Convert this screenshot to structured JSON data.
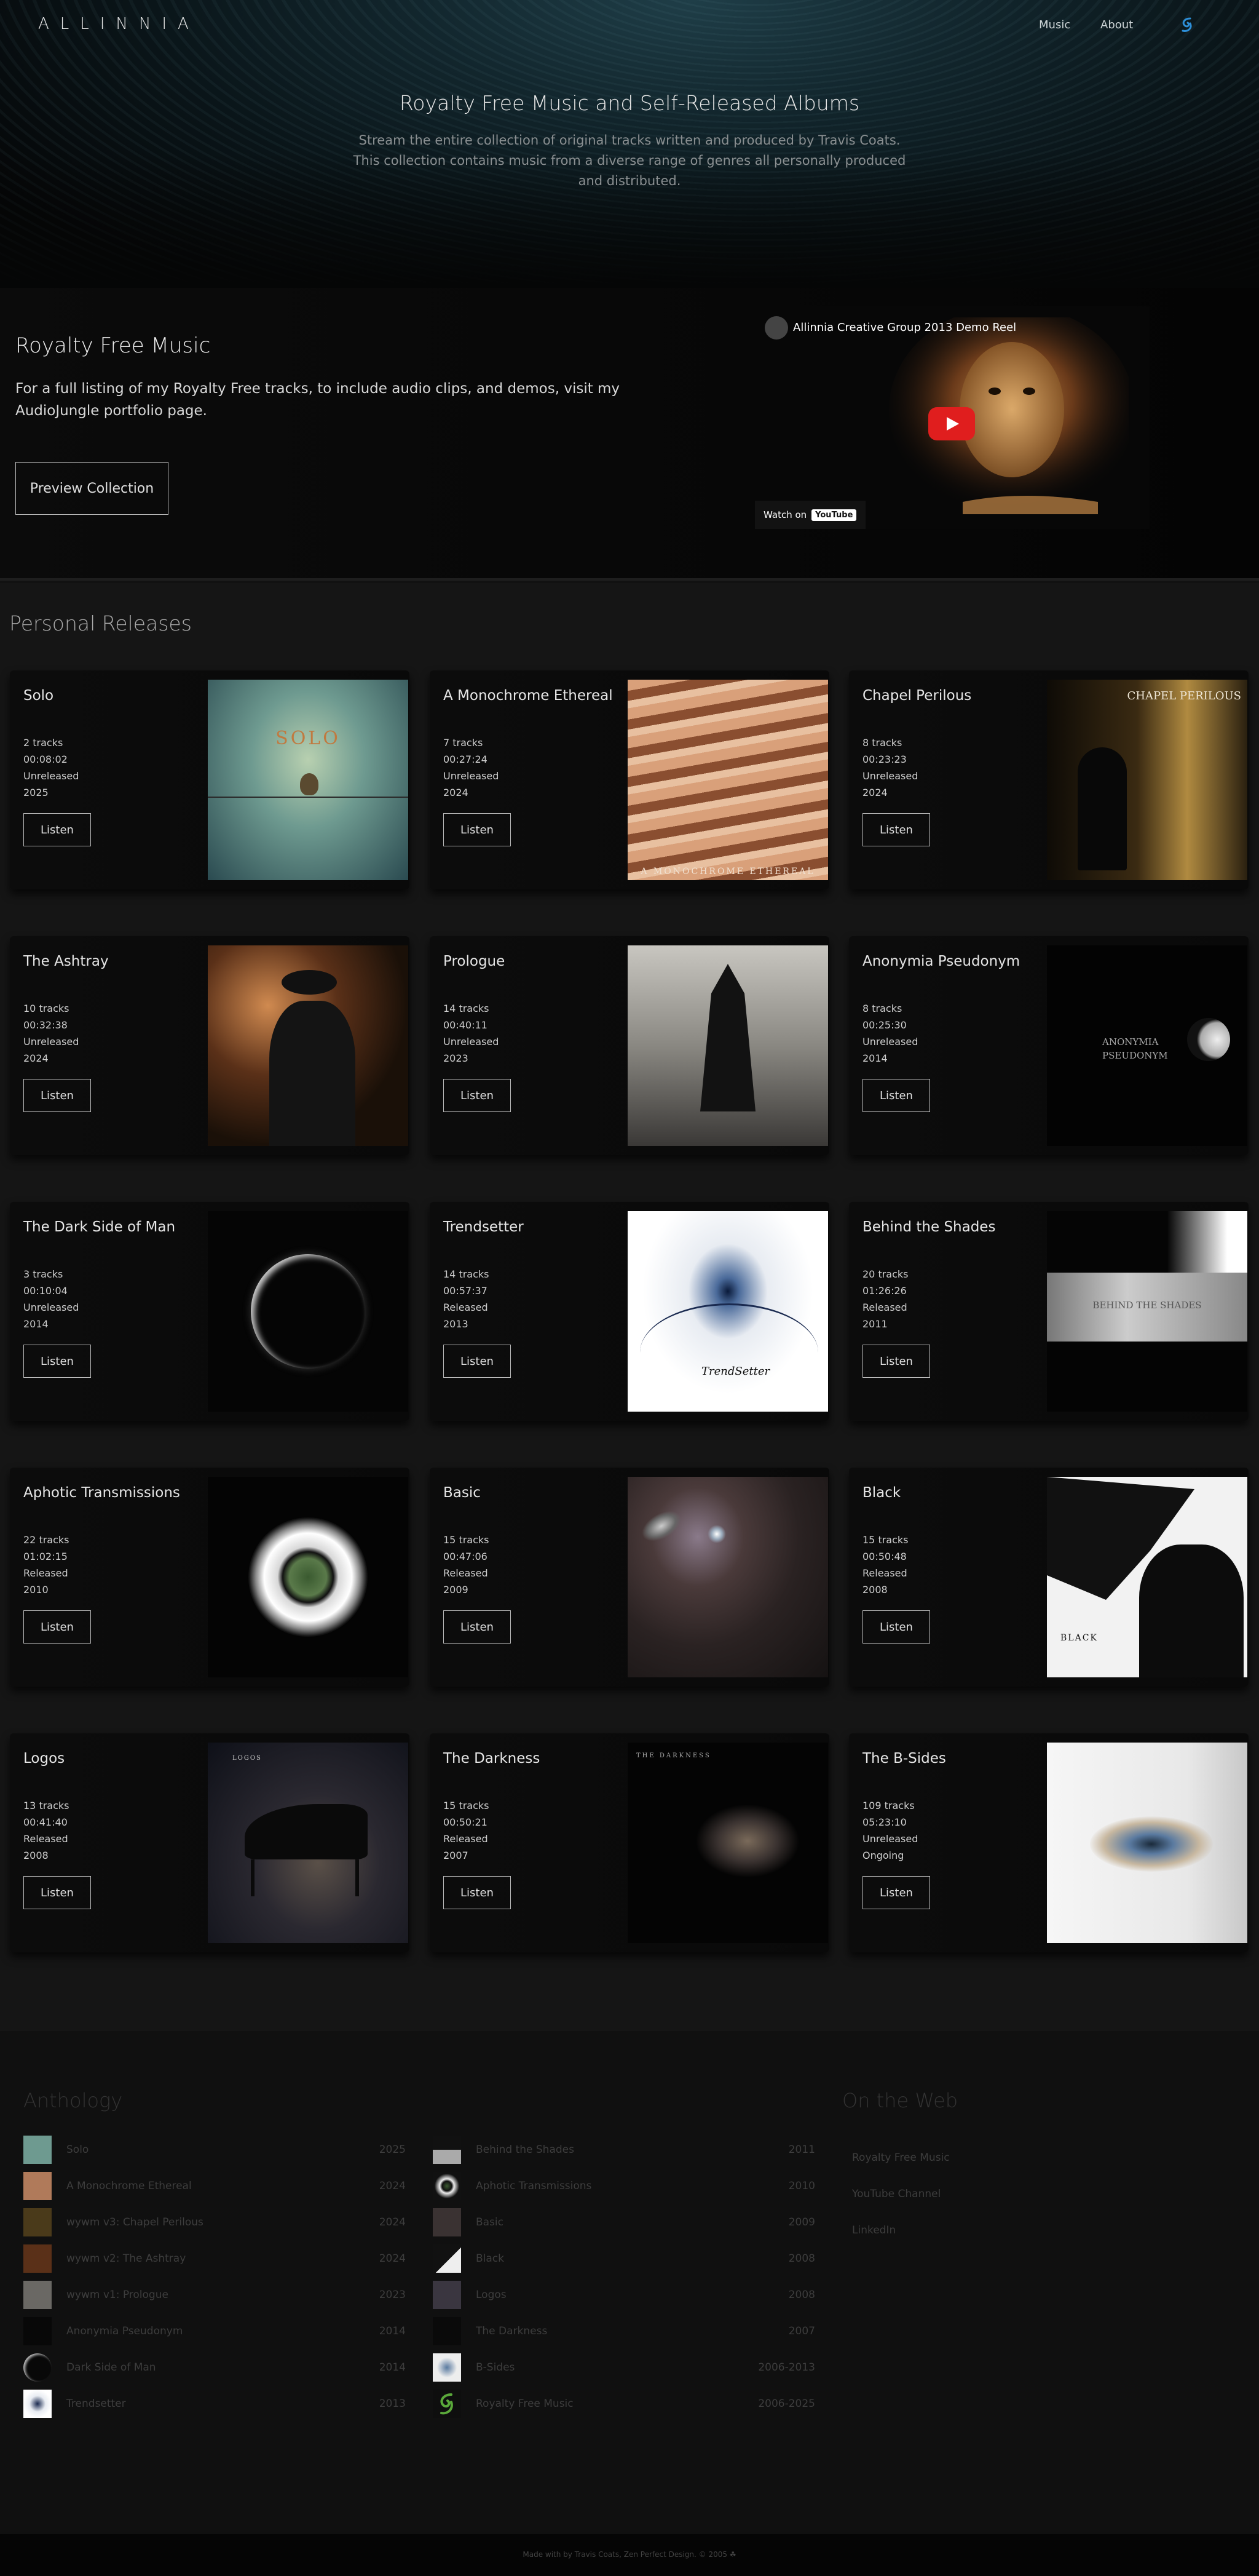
{
  "nav": {
    "logo": "ALLINNIA",
    "music": "Music",
    "about": "About",
    "icon": "swirl-logo-icon"
  },
  "hero": {
    "title": "Royalty Free Music and Self-Released Albums",
    "description": "Stream the entire collection of original tracks written and produced by Travis Coats. This collection contains music from a diverse range of genres all personally produced and distributed."
  },
  "royalty": {
    "title": "Royalty Free Music",
    "description": "For a full listing of my Royalty Free tracks, to include audio clips, and demos, visit my AudioJungle portfolio page.",
    "button": "Preview Collection",
    "video": {
      "title": "Allinnia Creative Group 2013 Demo Reel",
      "watch_on": "Watch on",
      "yt": "YouTube"
    }
  },
  "personal": {
    "title": "Personal Releases",
    "listen_label": "Listen",
    "albums": [
      {
        "title": "Solo",
        "tracks": "2 tracks",
        "duration": "00:08:02",
        "status": "Unreleased",
        "year": "2025",
        "cover_text": "SOLO"
      },
      {
        "title": "A Monochrome Ethereal",
        "tracks": "7 tracks",
        "duration": "00:27:24",
        "status": "Unreleased",
        "year": "2024",
        "cover_text": "A MONOCHROME ETHEREAL"
      },
      {
        "title": "Chapel Perilous",
        "tracks": "8 tracks",
        "duration": "00:23:23",
        "status": "Unreleased",
        "year": "2024",
        "cover_text": "CHAPEL PERILOUS"
      },
      {
        "title": "The Ashtray",
        "tracks": "10 tracks",
        "duration": "00:32:38",
        "status": "Unreleased",
        "year": "2024",
        "cover_text": ""
      },
      {
        "title": "Prologue",
        "tracks": "14 tracks",
        "duration": "00:40:11",
        "status": "Unreleased",
        "year": "2023",
        "cover_text": ""
      },
      {
        "title": "Anonymia Pseudonym",
        "tracks": "8 tracks",
        "duration": "00:25:30",
        "status": "Unreleased",
        "year": "2014",
        "cover_text": "ANONYMIA PSEUDONYM"
      },
      {
        "title": "The Dark Side of Man",
        "tracks": "3 tracks",
        "duration": "00:10:04",
        "status": "Unreleased",
        "year": "2014",
        "cover_text": ""
      },
      {
        "title": "Trendsetter",
        "tracks": "14 tracks",
        "duration": "00:57:37",
        "status": "Released",
        "year": "2013",
        "cover_text": "TrendSetter"
      },
      {
        "title": "Behind the Shades",
        "tracks": "20 tracks",
        "duration": "01:26:26",
        "status": "Released",
        "year": "2011",
        "cover_text": "BEHIND THE SHADES"
      },
      {
        "title": "Aphotic Transmissions",
        "tracks": "22 tracks",
        "duration": "01:02:15",
        "status": "Released",
        "year": "2010",
        "cover_text": ""
      },
      {
        "title": "Basic",
        "tracks": "15 tracks",
        "duration": "00:47:06",
        "status": "Released",
        "year": "2009",
        "cover_text": ""
      },
      {
        "title": "Black",
        "tracks": "15 tracks",
        "duration": "00:50:48",
        "status": "Released",
        "year": "2008",
        "cover_text": "BLACK"
      },
      {
        "title": "Logos",
        "tracks": "13 tracks",
        "duration": "00:41:40",
        "status": "Released",
        "year": "2008",
        "cover_text": "LOGOS"
      },
      {
        "title": "The Darkness",
        "tracks": "15 tracks",
        "duration": "00:50:21",
        "status": "Released",
        "year": "2007",
        "cover_text": "THE DARKNESS"
      },
      {
        "title": "The B-Sides",
        "tracks": "109 tracks",
        "duration": "05:23:10",
        "status": "Unreleased",
        "year": "Ongoing",
        "cover_text": ""
      }
    ]
  },
  "footer": {
    "anthology_title": "Anthology",
    "web_title": "On the Web",
    "anthology_left": [
      {
        "name": "Solo",
        "year": "2025"
      },
      {
        "name": "A Monochrome Ethereal",
        "year": "2024"
      },
      {
        "name": "wywm v3: Chapel Perilous",
        "year": "2024"
      },
      {
        "name": "wywm v2: The Ashtray",
        "year": "2024"
      },
      {
        "name": "wywm v1: Prologue",
        "year": "2023"
      },
      {
        "name": "Anonymia Pseudonym",
        "year": "2014"
      },
      {
        "name": "Dark Side of Man",
        "year": "2014"
      },
      {
        "name": "Trendsetter",
        "year": "2013"
      }
    ],
    "anthology_right": [
      {
        "name": "Behind the Shades",
        "year": "2011"
      },
      {
        "name": "Aphotic Transmissions",
        "year": "2010"
      },
      {
        "name": "Basic",
        "year": "2009"
      },
      {
        "name": "Black",
        "year": "2008"
      },
      {
        "name": "Logos",
        "year": "2008"
      },
      {
        "name": "The Darkness",
        "year": "2007"
      },
      {
        "name": "B-Sides",
        "year": "2006-2013"
      },
      {
        "name": "Royalty Free Music",
        "year": "2006-2025"
      }
    ],
    "web_links": [
      "Royalty Free Music",
      "YouTube Channel",
      "LinkedIn"
    ],
    "credits": "Made with by Travis Coats, Zen Perfect Design. © 2005 ☘"
  }
}
